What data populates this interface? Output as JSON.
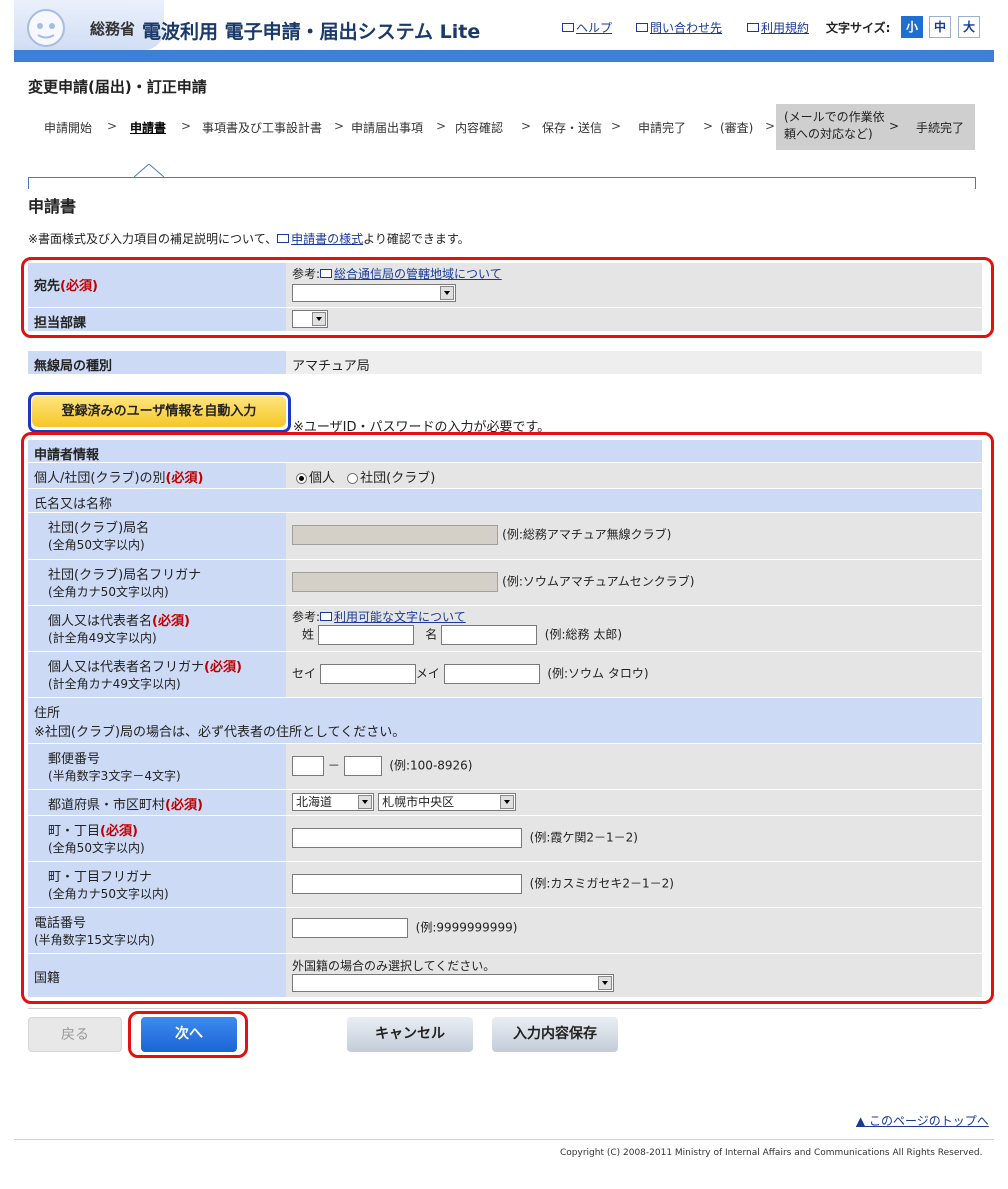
{
  "header": {
    "ministry": "総務省",
    "system_name": "電波利用 電子申請・届出システム Lite",
    "links": {
      "help": "ヘルプ",
      "contact": "問い合わせ先",
      "terms": "利用規約"
    },
    "font_size_label": "文字サイズ:",
    "font_sizes": [
      "小",
      "中",
      "大"
    ],
    "accent_color": "#3c7fd6"
  },
  "page_title": "変更申請(届出)・訂正申請",
  "steps": [
    "申請開始",
    "申請書",
    "事項書及び工事設計書",
    "申請届出事項",
    "内容確認",
    "保存・送信",
    "申請完了",
    "(審査)",
    "(メールでの作業依頼への対応など)",
    "手続完了"
  ],
  "section_title": "申請書",
  "note": {
    "prefix": "※書面様式及び入力項目の補足説明について、",
    "link": "申請書の様式",
    "suffix": "より確認できます。"
  },
  "dest": {
    "label": "宛先",
    "required": "(必須)",
    "ref_prefix": "参考:",
    "ref_link": "総合通信局の管轄地域について",
    "dept_label": "担当部課"
  },
  "station": {
    "label": "無線局の種別",
    "value": "アマチュア局"
  },
  "autofill": {
    "button": "登録済みのユーザ情報を自動入力",
    "note": "※ユーザID・パスワードの入力が必要です。"
  },
  "applicant": {
    "header": "申請者情報",
    "type_label": "個人/社団(クラブ)の別",
    "required": "(必須)",
    "type_options": [
      "個人",
      "社団(クラブ)"
    ],
    "name_header": "氏名又は名称",
    "club_name": {
      "label": "社団(クラブ)局名",
      "sub": "(全角50文字以内)",
      "example": "(例:総務アマチュア無線クラブ)"
    },
    "club_kana": {
      "label": "社団(クラブ)局名フリガナ",
      "sub": "(全角カナ50文字以内)",
      "example": "(例:ソウムアマチュアムセンクラブ)"
    },
    "rep_name": {
      "label": "個人又は代表者名",
      "sub": "(計全角49文字以内)",
      "ref_prefix": "参考:",
      "ref_link": "利用可能な文字について",
      "sei": "姓",
      "mei": "名",
      "example": "(例:総務 太郎)"
    },
    "rep_kana": {
      "label": "個人又は代表者名フリガナ",
      "sub": "(計全角カナ49文字以内)",
      "sei": "セイ",
      "mei": "メイ",
      "example": "(例:ソウム タロウ)"
    },
    "address_header": "住所",
    "address_note": "※社団(クラブ)局の場合は、必ず代表者の住所としてください。",
    "zip": {
      "label": "郵便番号",
      "sub": "(半角数字3文字－4文字)",
      "dash": "－",
      "example": "(例:100-8926)"
    },
    "pref": {
      "label": "都道府県・市区町村",
      "pref_value": "北海道",
      "city_value": "札幌市中央区"
    },
    "town": {
      "label": "町・丁目",
      "sub": "(全角50文字以内)",
      "example": "(例:霞ケ関2－1－2)"
    },
    "town_kana": {
      "label": "町・丁目フリガナ",
      "sub": "(全角カナ50文字以内)",
      "example": "(例:カスミガセキ2－1－2)"
    },
    "phone": {
      "label": "電話番号",
      "sub": "(半角数字15文字以内)",
      "example": "(例:9999999999)"
    },
    "nationality": {
      "label": "国籍",
      "note": "外国籍の場合のみ選択してください。"
    }
  },
  "buttons": {
    "back": "戻る",
    "next": "次へ",
    "cancel": "キャンセル",
    "save": "入力内容保存"
  },
  "page_top": "このページのトップへ",
  "copyright": "Copyright (C) 2008-2011 Ministry of Internal Affairs and Communications All Rights Reserved."
}
